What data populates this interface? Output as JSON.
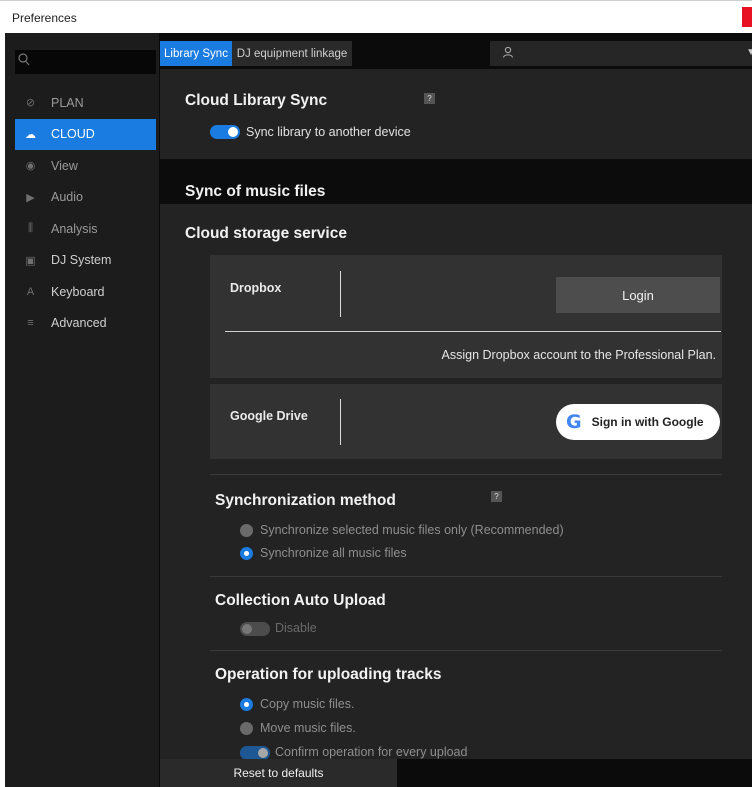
{
  "window": {
    "title": "Preferences"
  },
  "sidebar": {
    "search_placeholder": "",
    "items": [
      {
        "label": "PLAN",
        "icon": "plan-icon",
        "glyph": "⊘"
      },
      {
        "label": "CLOUD",
        "icon": "cloud-icon",
        "glyph": "☁"
      },
      {
        "label": "View",
        "icon": "eye-icon",
        "glyph": "◉"
      },
      {
        "label": "Audio",
        "icon": "speaker-icon",
        "glyph": "▶"
      },
      {
        "label": "Analysis",
        "icon": "waveform-icon",
        "glyph": "⫼"
      },
      {
        "label": "DJ System",
        "icon": "dj-system-icon",
        "glyph": "▣"
      },
      {
        "label": "Keyboard",
        "icon": "keyboard-icon",
        "glyph": "A"
      },
      {
        "label": "Advanced",
        "icon": "menu-icon",
        "glyph": "≡"
      }
    ]
  },
  "tabs": {
    "library_sync": "Library Sync",
    "dj_equipment": "DJ equipment linkage"
  },
  "main": {
    "cloud_library_sync_title": "Cloud Library Sync",
    "sync_toggle_label": "Sync library to another device",
    "sync_toggle_on": true,
    "sync_music_files_title": "Sync of music files",
    "cloud_storage_title": "Cloud storage service",
    "dropbox": {
      "name": "Dropbox",
      "login_label": "Login",
      "assign_text": "Assign Dropbox account to the Professional Plan."
    },
    "google_drive": {
      "name": "Google Drive",
      "signin_label": "Sign in with Google"
    },
    "sync_method": {
      "title": "Synchronization method",
      "options": [
        {
          "label": "Synchronize selected music files only (Recommended)",
          "selected": false
        },
        {
          "label": "Synchronize all music files",
          "selected": true
        }
      ]
    },
    "collection_upload": {
      "title": "Collection Auto Upload",
      "toggle_label": "Disable",
      "toggle_on": false
    },
    "upload_operation": {
      "title": "Operation for uploading tracks",
      "options": [
        {
          "label": "Copy music files.",
          "selected": true
        },
        {
          "label": "Move music files.",
          "selected": false
        }
      ],
      "confirm_label": "Confirm operation for every upload"
    },
    "help_glyph": "?"
  },
  "footer": {
    "reset_label": "Reset to defaults"
  },
  "colors": {
    "accent": "#1a7be0",
    "panel": "#232323",
    "sidebar": "#1c1c1c"
  }
}
